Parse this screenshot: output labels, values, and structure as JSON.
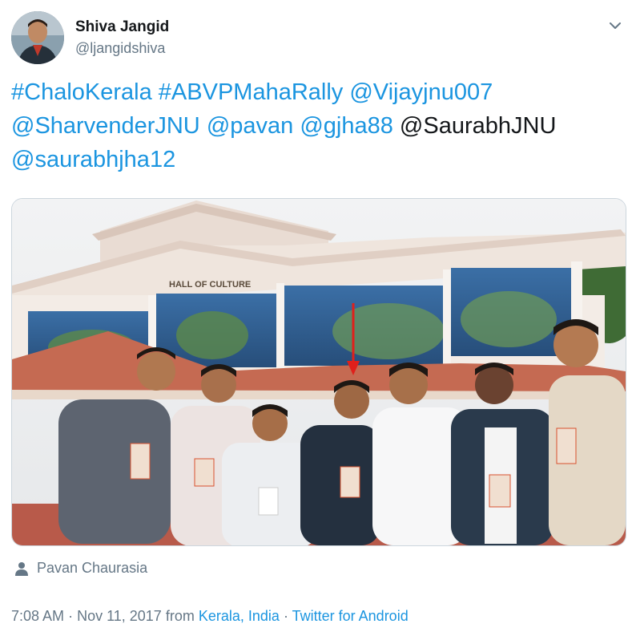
{
  "author": {
    "name": "Shiva Jangid",
    "handle": "@ljangidshiva"
  },
  "tweet": {
    "parts": [
      {
        "text": "#ChaloKerala",
        "link": true
      },
      {
        "text": " ",
        "link": false
      },
      {
        "text": "#ABVPMahaRally",
        "link": true
      },
      {
        "text": " ",
        "link": false
      },
      {
        "text": "@Vijayjnu007",
        "link": true
      },
      {
        "text": " ",
        "link": false
      },
      {
        "text": "@SharvenderJNU",
        "link": true
      },
      {
        "text": " ",
        "link": false
      },
      {
        "text": "@pavan",
        "link": true
      },
      {
        "text": " ",
        "link": false
      },
      {
        "text": "@gjha88",
        "link": true
      },
      {
        "text": " @SaurabhJNU ",
        "link": false
      },
      {
        "text": "@saurabhjha12",
        "link": true
      }
    ]
  },
  "media": {
    "building_sign": "HALL OF CULTURE",
    "photo_credit": "Pavan Chaurasia"
  },
  "footer": {
    "time": "7:08 AM",
    "date": "Nov 11, 2017",
    "from_label": "from",
    "location": "Kerala, India",
    "separator": "·",
    "source": "Twitter for Android"
  },
  "colors": {
    "link": "#1b95e0",
    "text": "#14171a",
    "secondary": "#657786",
    "arrow": "#e0201b"
  },
  "icons": [
    "chevron-down-icon",
    "person-icon"
  ]
}
